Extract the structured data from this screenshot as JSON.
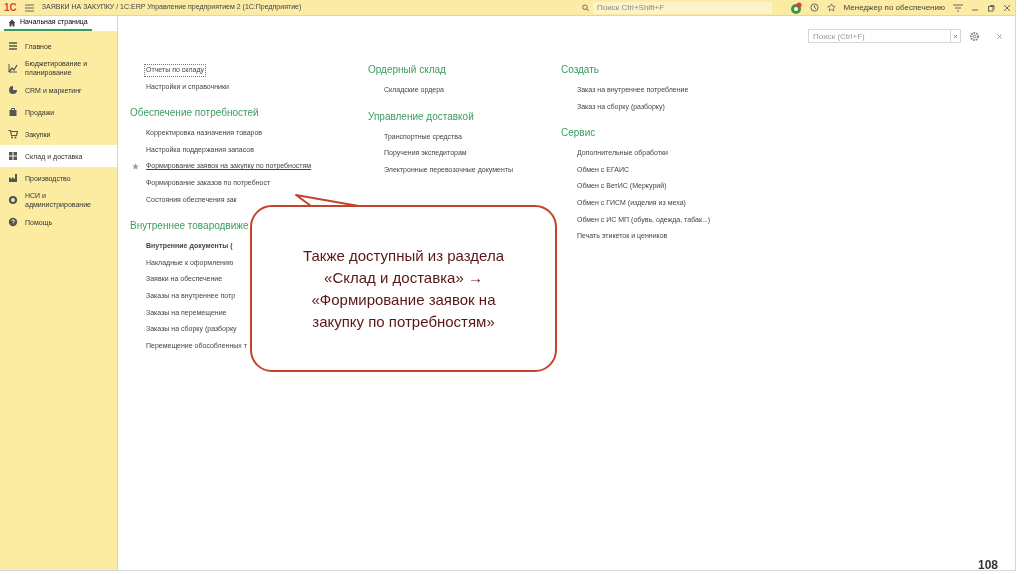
{
  "title_bar": {
    "logo": "1С",
    "title": "ЗАЯВКИ НА ЗАКУПКУ / 1С:ERP Управление предприятием 2  (1С:Предприятие)",
    "search": {
      "placeholder": "Поиск Ctrl+Shift+F"
    },
    "user": "Менеджер по обеспечению"
  },
  "home_tab": {
    "label": "Начальная страница",
    "selected": true
  },
  "sidebar": {
    "items": [
      {
        "label": "Главное",
        "selected": false
      },
      {
        "label": "Бюджетирование и планирование",
        "selected": false
      },
      {
        "label": "CRM и маркетинг",
        "selected": false
      },
      {
        "label": "Продажи",
        "selected": false
      },
      {
        "label": "Закупки",
        "selected": false
      },
      {
        "label": "Склад и доставка",
        "selected": true
      },
      {
        "label": "Производство",
        "selected": false
      },
      {
        "label": "НСИ и администрирование",
        "selected": false
      },
      {
        "label": "Помощь",
        "selected": false
      }
    ]
  },
  "content": {
    "search": {
      "placeholder": "Поиск (Ctrl+F)"
    },
    "columns": [
      {
        "sections": [
          {
            "items": [
              {
                "label": "Отчеты по складу",
                "bold": false,
                "favorite": false,
                "focused": true,
                "hovered": false
              },
              {
                "label": "Настройки и справочники",
                "bold": false,
                "favorite": false,
                "focused": false,
                "hovered": false
              }
            ]
          },
          {
            "title": "Обеспечение потребностей",
            "items": [
              {
                "label": "Корректировка назначения товаров",
                "bold": false,
                "favorite": false,
                "focused": false,
                "hovered": false
              },
              {
                "label": "Настройка поддержания запасов",
                "bold": false,
                "favorite": false,
                "focused": false,
                "hovered": false
              },
              {
                "label": "Формирование заявок на закупку по потребностям",
                "bold": false,
                "favorite": true,
                "focused": false,
                "hovered": true
              },
              {
                "label": "Формирование заказов по потребност",
                "bold": false,
                "favorite": false,
                "focused": false,
                "hovered": false
              },
              {
                "label": "Состояния обеспечения зак",
                "bold": false,
                "favorite": false,
                "focused": false,
                "hovered": false
              }
            ]
          },
          {
            "title": "Внутреннее товародвиже",
            "items": [
              {
                "label": "Внутренние документы (",
                "bold": true,
                "favorite": false,
                "focused": false,
                "hovered": false
              },
              {
                "label": "Накладные к оформлению",
                "bold": false,
                "favorite": false,
                "focused": false,
                "hovered": false
              },
              {
                "label": "Заявки на обеспечение",
                "bold": false,
                "favorite": false,
                "focused": false,
                "hovered": false
              },
              {
                "label": "Заказы на внутреннее потр",
                "bold": false,
                "favorite": false,
                "focused": false,
                "hovered": false
              },
              {
                "label": "Заказы на перемещение",
                "bold": false,
                "favorite": false,
                "focused": false,
                "hovered": false
              },
              {
                "label": "Заказы на сборку (разборку",
                "bold": false,
                "favorite": false,
                "focused": false,
                "hovered": false
              },
              {
                "label": "Перемещение обособленных т",
                "bold": false,
                "favorite": false,
                "focused": false,
                "hovered": false
              }
            ]
          }
        ]
      },
      {
        "sections": [
          {
            "title": "Ордерный склад",
            "items": [
              {
                "label": "Складские ордера",
                "bold": false,
                "favorite": false,
                "focused": false,
                "hovered": false
              }
            ]
          },
          {
            "title": "Управление доставкой",
            "items": [
              {
                "label": "Транспортные средства",
                "bold": false,
                "favorite": false,
                "focused": false,
                "hovered": false
              },
              {
                "label": "Поручения экспедиторам",
                "bold": false,
                "favorite": false,
                "focused": false,
                "hovered": false
              },
              {
                "label": "Электронные перевозочные документы",
                "bold": false,
                "favorite": false,
                "focused": false,
                "hovered": false
              }
            ]
          }
        ]
      },
      {
        "sections": [
          {
            "title": "Создать",
            "items": [
              {
                "label": "Заказ на внутреннее потребление",
                "bold": false,
                "favorite": false,
                "focused": false,
                "hovered": false
              },
              {
                "label": "Заказ на сборку (разборку)",
                "bold": false,
                "favorite": false,
                "focused": false,
                "hovered": false
              }
            ]
          },
          {
            "title": "Сервис",
            "items": [
              {
                "label": "Дополнительные обработки",
                "bold": false,
                "favorite": false,
                "focused": false,
                "hovered": false
              },
              {
                "label": "Обмен с ЕГАИС",
                "bold": false,
                "favorite": false,
                "focused": false,
                "hovered": false
              },
              {
                "label": "Обмен с ВетИС (Меркурий)",
                "bold": false,
                "favorite": false,
                "focused": false,
                "hovered": false
              },
              {
                "label": "Обмен с ГИСМ (изделия из меха)",
                "bold": false,
                "favorite": false,
                "focused": false,
                "hovered": false
              },
              {
                "label": "Обмен с ИС МП (обувь, одежда, табак...)",
                "bold": false,
                "favorite": false,
                "focused": false,
                "hovered": false
              },
              {
                "label": "Печать этикеток и ценников",
                "bold": false,
                "favorite": false,
                "focused": false,
                "hovered": false
              }
            ]
          }
        ]
      }
    ]
  },
  "callout": {
    "text": "Также доступный из раздела «Склад и доставка» → «Формирование заявок на закупку по потребностям»"
  },
  "slide_number": "108"
}
